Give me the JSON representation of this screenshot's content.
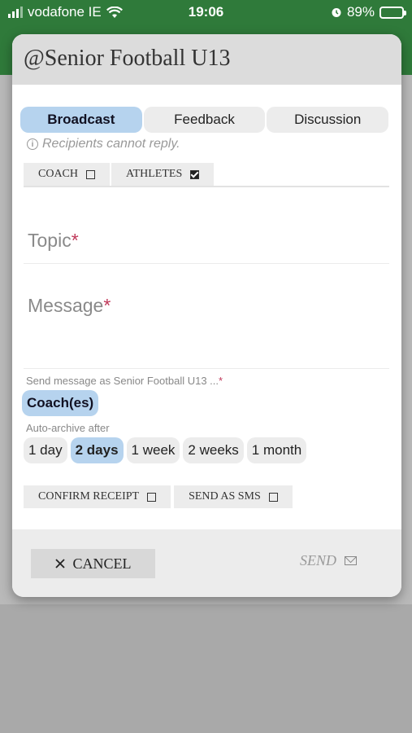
{
  "status_bar": {
    "carrier": "vodafone IE",
    "time": "19:06",
    "battery": "89%",
    "battery_level": 0.89
  },
  "dialog": {
    "title": "@Senior Football U13"
  },
  "tabs": [
    {
      "label": "Broadcast",
      "active": true
    },
    {
      "label": "Feedback",
      "active": false
    },
    {
      "label": "Discussion",
      "active": false
    }
  ],
  "info": {
    "icon": "info-icon",
    "text": "Recipients cannot reply."
  },
  "recipients": [
    {
      "label": "COACH",
      "checked": false
    },
    {
      "label": "ATHLETES",
      "checked": true
    }
  ],
  "fields": {
    "topic_placeholder": "Topic",
    "message_placeholder": "Message",
    "required_mark": "*"
  },
  "send_as": {
    "label": "Send message as Senior Football U13 ...",
    "required_mark": "*",
    "value": "Coach(es)"
  },
  "auto_archive": {
    "label": "Auto-archive after",
    "options": [
      "1 day",
      "2 days",
      "1 week",
      "2 weeks",
      "1 month"
    ],
    "selected": "2 days"
  },
  "options": [
    {
      "label": "CONFIRM RECEIPT",
      "checked": false
    },
    {
      "label": "SEND AS SMS",
      "checked": false
    }
  ],
  "footer": {
    "cancel_label": "CANCEL",
    "send_label": "SEND"
  },
  "colors": {
    "app_green": "#2f7a3a",
    "accent_blue": "#b6d3ee",
    "required_red": "#c0395a"
  }
}
